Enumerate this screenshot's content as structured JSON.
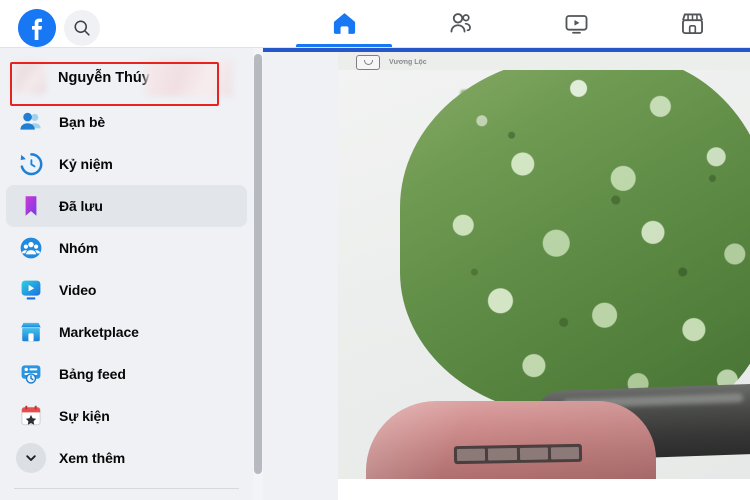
{
  "header": {
    "logo_icon": "facebook-logo-icon",
    "search_icon": "search-icon",
    "tabs": [
      {
        "id": "home",
        "icon": "home-icon",
        "label": "Trang chủ",
        "active": true
      },
      {
        "id": "friends",
        "icon": "friends-icon",
        "label": "Bạn bè",
        "active": false
      },
      {
        "id": "video",
        "icon": "video-icon",
        "label": "Video",
        "active": false
      },
      {
        "id": "marketplace",
        "icon": "marketplace-icon",
        "label": "Marketplace",
        "active": false
      }
    ]
  },
  "sidebar": {
    "profile": {
      "name": "Nguyễn Thúy",
      "avatar_icon": "profile-avatar-blurred",
      "highlighted": true,
      "highlight_color": "#e8221f"
    },
    "items": [
      {
        "id": "friends",
        "label": "Bạn bè",
        "icon": "friends-icon",
        "active": false
      },
      {
        "id": "memories",
        "label": "Kỷ niệm",
        "icon": "clock-history-icon",
        "active": false
      },
      {
        "id": "saved",
        "label": "Đã lưu",
        "icon": "bookmark-icon",
        "active": true
      },
      {
        "id": "groups",
        "label": "Nhóm",
        "icon": "groups-icon",
        "active": false
      },
      {
        "id": "video",
        "label": "Video",
        "icon": "video-play-icon",
        "active": false
      },
      {
        "id": "marketplace",
        "label": "Marketplace",
        "icon": "storefront-icon",
        "active": false
      },
      {
        "id": "feeds",
        "label": "Bảng feed",
        "icon": "feeds-icon",
        "active": false
      },
      {
        "id": "events",
        "label": "Sự kiện",
        "icon": "calendar-star-icon",
        "active": false
      },
      {
        "id": "see-more",
        "label": "Xem thêm",
        "icon": "chevron-down-icon",
        "active": false
      }
    ],
    "scrollbar": {
      "name": "sidebar-scrollbar"
    }
  },
  "content": {
    "mini_header_label": "Vương Lộc",
    "mini_header_icon": "video-camera-icon",
    "photo_description": "Cây xanh và nóc xe màu hồng"
  },
  "colors": {
    "brand_blue": "#1877f2",
    "accent_strip": "#2657c8",
    "sidebar_bg": "#eff1f4",
    "active_item_bg": "#e2e5e9",
    "highlight_red": "#e8221f"
  }
}
